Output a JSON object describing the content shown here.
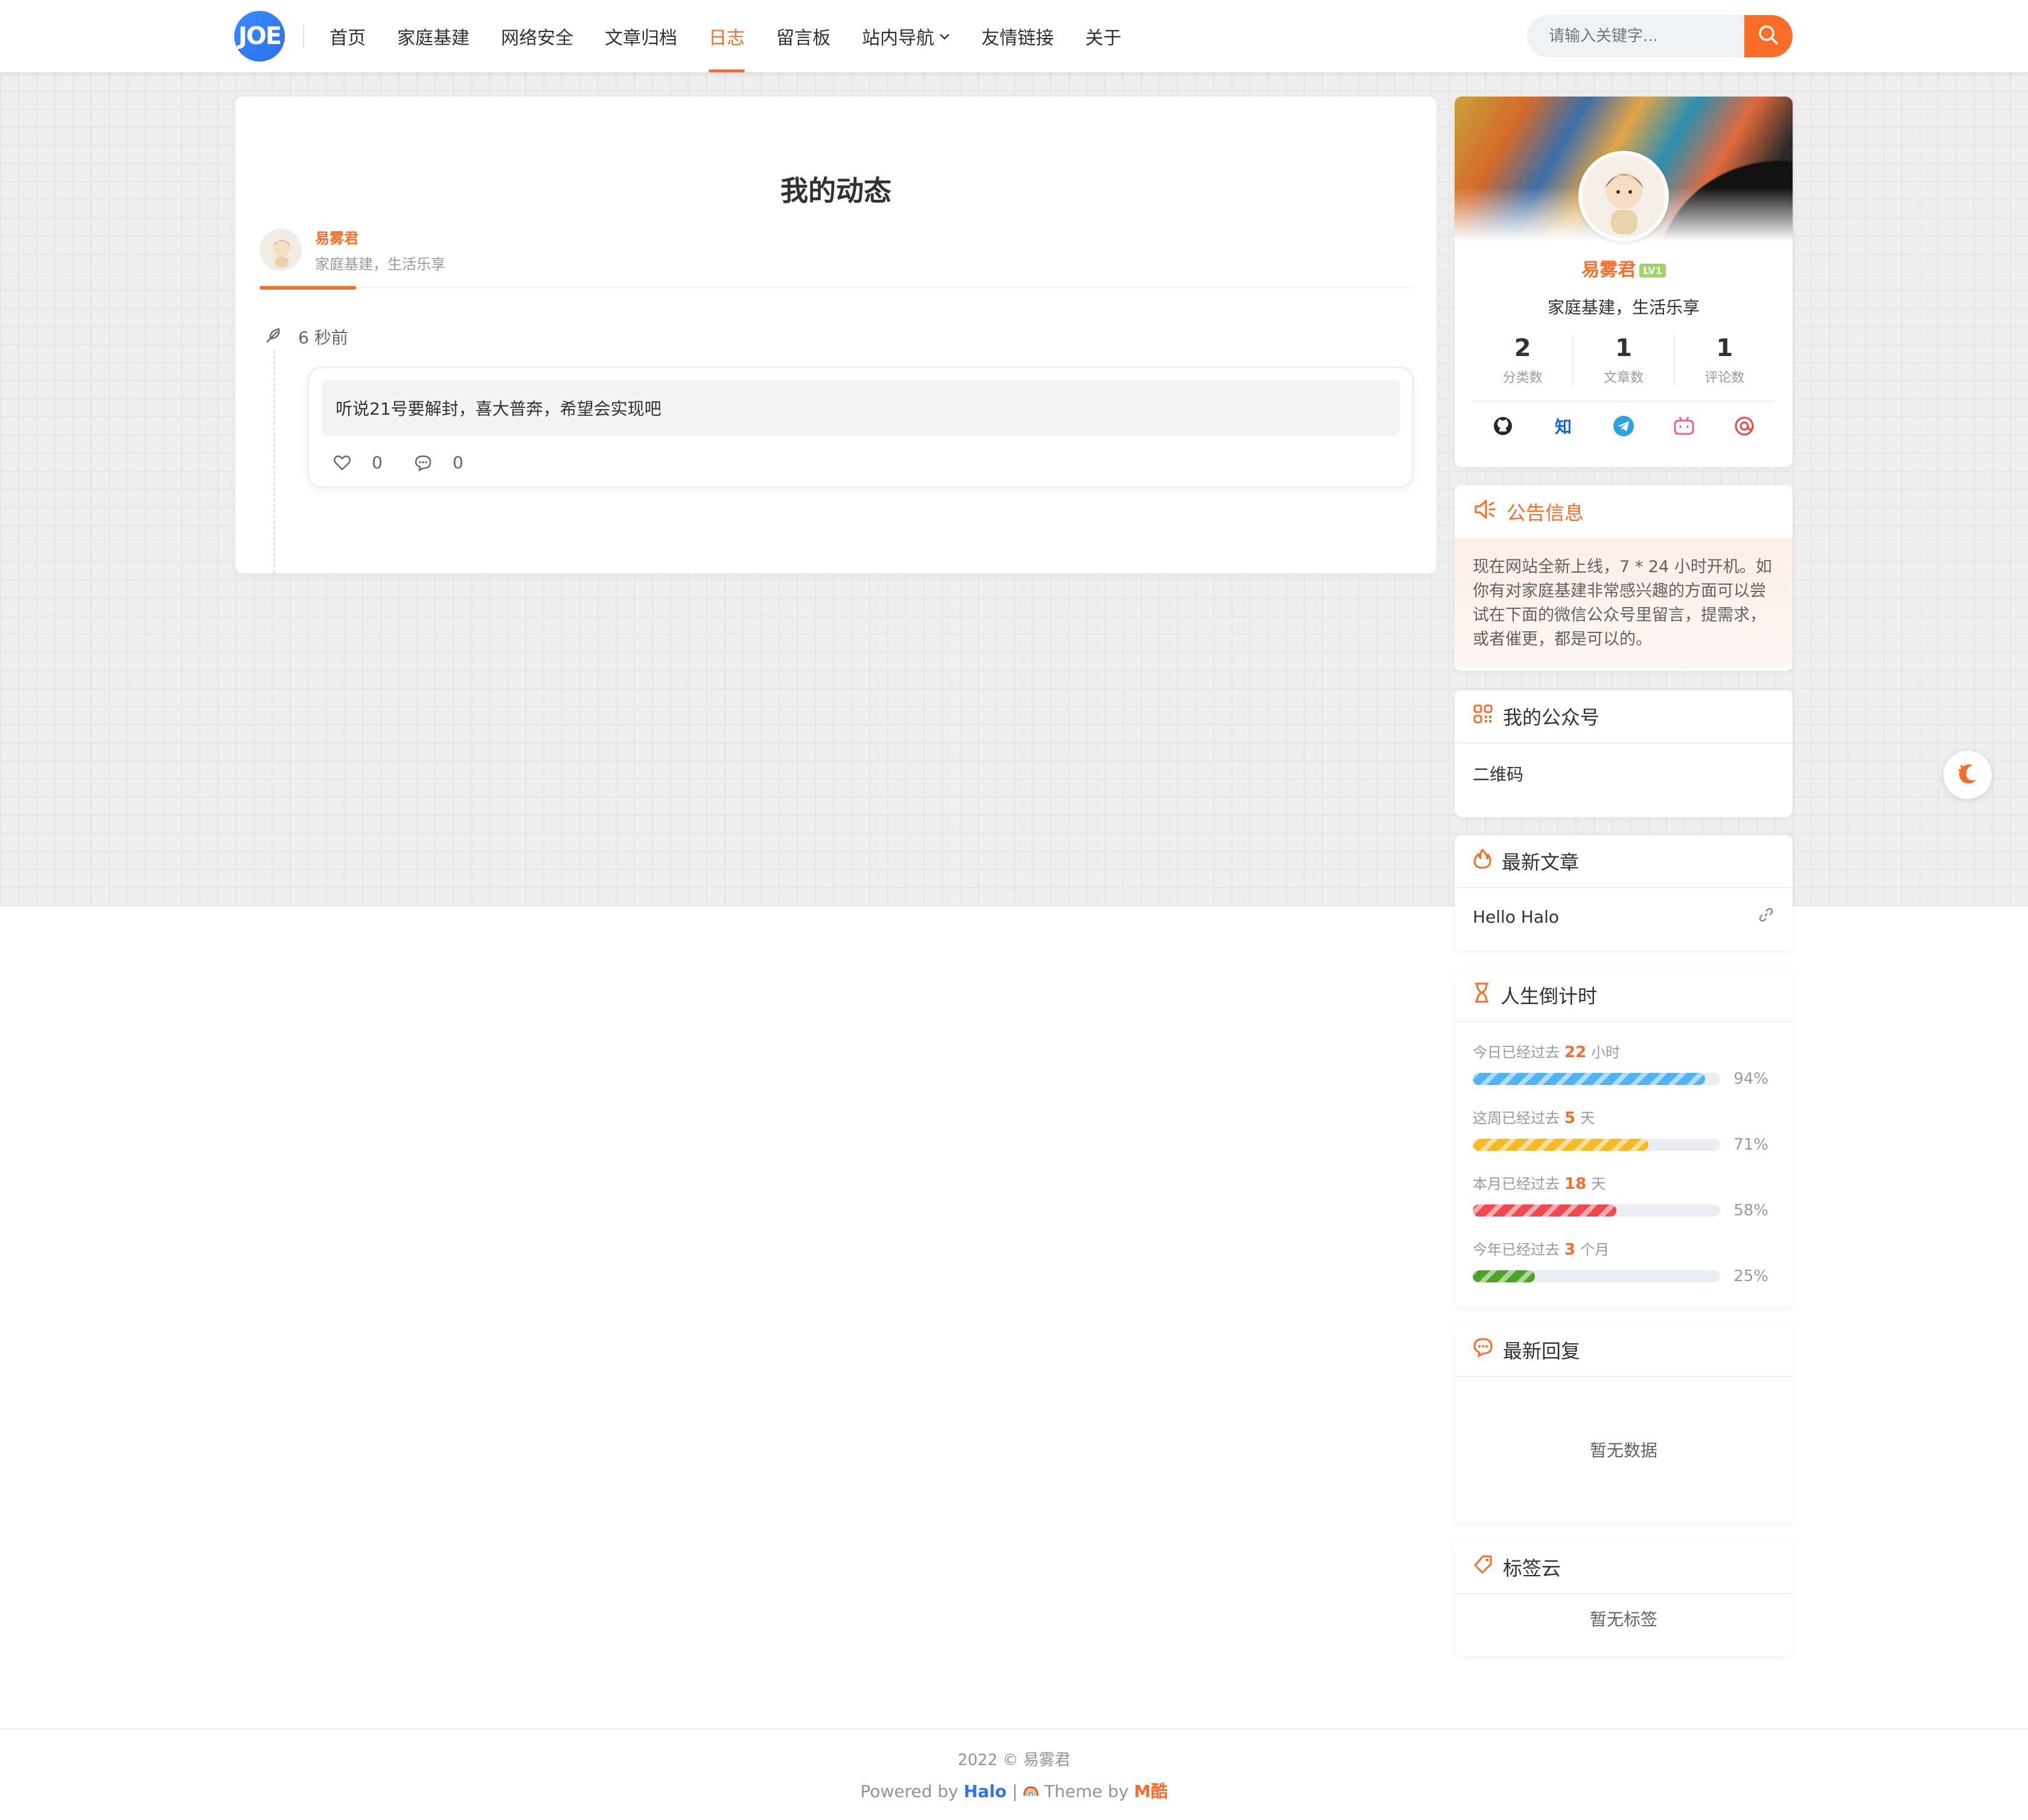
{
  "header": {
    "logo_text": "JOE",
    "nav": [
      {
        "label": "首页"
      },
      {
        "label": "家庭基建"
      },
      {
        "label": "网络安全"
      },
      {
        "label": "文章归档"
      },
      {
        "label": "日志"
      },
      {
        "label": "留言板"
      },
      {
        "label": "站内导航"
      },
      {
        "label": "友情链接"
      },
      {
        "label": "关于"
      }
    ],
    "active_nav": "日志",
    "search_placeholder": "请输入关键字..."
  },
  "main": {
    "title": "我的动态",
    "author_name": "易雾君",
    "author_desc": "家庭基建，生活乐享",
    "moment": {
      "time": "6 秒前",
      "content": "听说21号要解封，喜大普奔，希望会实现吧",
      "likes": "0",
      "comments": "0"
    }
  },
  "sidebar": {
    "profile": {
      "name": "易雾君",
      "level": "LV1",
      "motto": "家庭基建，生活乐享",
      "stats": [
        {
          "num": "2",
          "label": "分类数"
        },
        {
          "num": "1",
          "label": "文章数"
        },
        {
          "num": "1",
          "label": "评论数"
        }
      ],
      "zhihu_label": "知"
    },
    "notice": {
      "title": "公告信息",
      "body": "现在网站全新上线，7 * 24 小时开机。如你有对家庭基建非常感兴趣的方面可以尝试在下面的微信公众号里留言，提需求，或者催更，都是可以的。"
    },
    "wechat": {
      "title": "我的公众号",
      "body": "二维码"
    },
    "latest": {
      "title": "最新文章",
      "items": [
        {
          "title": "Hello Halo"
        }
      ]
    },
    "countdown": {
      "title": "人生倒计时",
      "items": [
        {
          "prefix": "今日已经过去",
          "value": "22",
          "unit": "小时",
          "percent": 94,
          "percent_text": "94%",
          "color": "#4fb3f6"
        },
        {
          "prefix": "这周已经过去",
          "value": "5",
          "unit": "天",
          "percent": 71,
          "percent_text": "71%",
          "color": "#f7b924"
        },
        {
          "prefix": "本月已经过去",
          "value": "18",
          "unit": "天",
          "percent": 58,
          "percent_text": "58%",
          "color": "#f04852"
        },
        {
          "prefix": "今年已经过去",
          "value": "3",
          "unit": "个月",
          "percent": 25,
          "percent_text": "25%",
          "color": "#4ca427"
        }
      ]
    },
    "replies": {
      "title": "最新回复",
      "empty": "暂无数据"
    },
    "tags": {
      "title": "标签云",
      "empty": "暂无标签"
    }
  },
  "footer": {
    "copyright": "2022 © 易雾君",
    "powered_prefix": "Powered by",
    "powered_name": "Halo",
    "sep": "|",
    "theme_prefix": "Theme by",
    "theme_name": "M酷"
  }
}
